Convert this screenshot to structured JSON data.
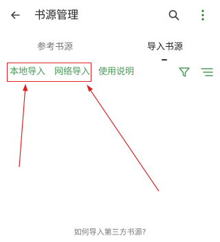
{
  "appbar": {
    "back_icon": "arrow-left-icon",
    "title": "书源管理",
    "search_icon": "search-icon",
    "more_icon": "more-vertical-icon"
  },
  "tabs": [
    {
      "label": "参考书源",
      "selected": false
    },
    {
      "label": "导入书源",
      "selected": true
    }
  ],
  "toolbar": {
    "local_import": "本地导入",
    "network_import": "网络导入",
    "usage_help": "使用说明",
    "filter_icon": "filter-icon",
    "sort_icon": "sort-icon"
  },
  "footer": {
    "help_link": "如何导入第三方书源?"
  },
  "colors": {
    "accent": "#4a9a57",
    "annotation": "#e02020",
    "text": "#222222",
    "muted": "#777777"
  }
}
